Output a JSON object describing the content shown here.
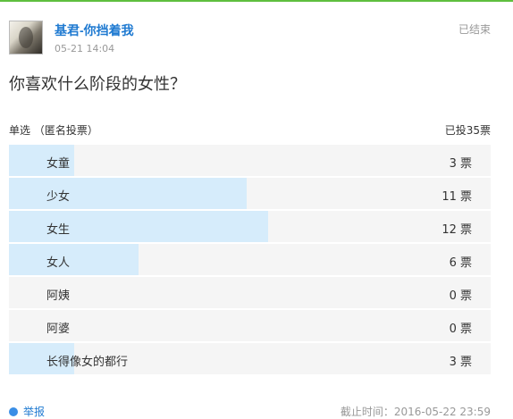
{
  "poll": {
    "author": "基君-你挡着我",
    "post_time": "05-21 14:04",
    "status": "已结束",
    "question": "你喜欢什么阶段的女性？",
    "vote_type": "单选 （匿名投票）",
    "total_votes": "已投35票",
    "options": [
      {
        "label": "女童",
        "count": "3 票",
        "votes": 3
      },
      {
        "label": "少女",
        "count": "11 票",
        "votes": 11
      },
      {
        "label": "女生",
        "count": "12 票",
        "votes": 12
      },
      {
        "label": "女人",
        "count": "6 票",
        "votes": 6
      },
      {
        "label": "阿姨",
        "count": "0 票",
        "votes": 0
      },
      {
        "label": "阿婆",
        "count": "0 票",
        "votes": 0
      },
      {
        "label": "长得像女的都行",
        "count": "3 票",
        "votes": 3
      }
    ],
    "report_label": "举报",
    "deadline": "截止时间：2016-05-22 23:59"
  },
  "colors": {
    "accent": "#1f7ad1",
    "bar_fill": "#d6ecfb",
    "row_bg": "#f5f5f5",
    "top_line": "#5fbf3f"
  },
  "icons": {
    "avatar": "user-avatar",
    "report": "report-icon"
  }
}
